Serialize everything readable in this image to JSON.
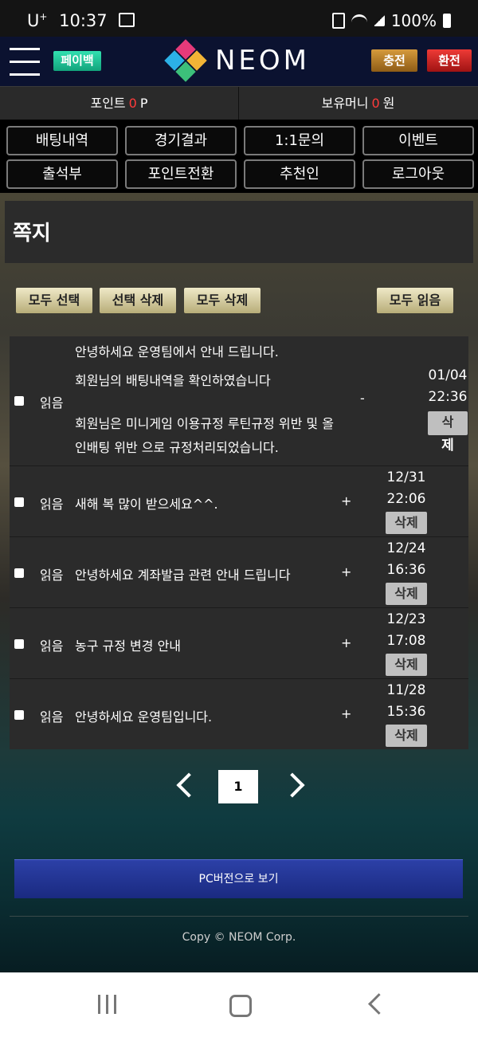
{
  "status_bar": {
    "carrier": "U",
    "carrier_sup": "+",
    "time": "10:37",
    "battery": "100%",
    "icons": [
      "gallery-icon",
      "nfc-icon",
      "wifi-icon",
      "signal-icon",
      "battery-icon"
    ]
  },
  "header": {
    "payback_label": "페이백",
    "logo_text": "NEOM",
    "charge_label": "충전",
    "exchange_label": "환전"
  },
  "balance": {
    "points_label": "포인트",
    "points_value": "0",
    "points_unit": "P",
    "money_label": "보유머니",
    "money_value": "0",
    "money_unit": "원"
  },
  "menu": [
    "배팅내역",
    "경기결과",
    "1:1문의",
    "이벤트",
    "출석부",
    "포인트전환",
    "추천인",
    "로그아웃"
  ],
  "page_title": "쪽지",
  "actions": {
    "select_all": "모두 선택",
    "delete_selected": "선택 삭제",
    "delete_all": "모두 삭제",
    "read_all": "모두 읽음"
  },
  "messages": [
    {
      "read_label": "읽음",
      "subject": "안녕하세요 운영팀에서 안내 드립니다.",
      "body_lines": [
        "회원님의 배팅내역을 확인하였습니다",
        "회원님은 미니게임 이용규정 루틴규정 위반 및 올",
        "인배팅 위반 으로 규정처리되었습니다."
      ],
      "toggle": "-",
      "date": "01/04",
      "time": "22:36",
      "delete_label_1": "삭",
      "delete_label_2": "제"
    },
    {
      "read_label": "읽음",
      "subject": "새해 복 많이 받으세요^^.",
      "toggle": "+",
      "date": "12/31",
      "time": "22:06",
      "delete_label": "삭제"
    },
    {
      "read_label": "읽음",
      "subject": "안녕하세요 계좌발급 관련 안내 드립니다",
      "toggle": "+",
      "date": "12/24",
      "time": "16:36",
      "delete_label": "삭제"
    },
    {
      "read_label": "읽음",
      "subject": "농구 규정 변경 안내",
      "toggle": "+",
      "date": "12/23",
      "time": "17:08",
      "delete_label": "삭제"
    },
    {
      "read_label": "읽음",
      "subject": "안녕하세요 운영팀입니다.",
      "toggle": "+",
      "date": "11/28",
      "time": "15:36",
      "delete_label": "삭제"
    }
  ],
  "pagination": {
    "current": "1"
  },
  "pc_version_label": "PC버전으로 보기",
  "footer": "Copy © NEOM Corp.",
  "colors": {
    "accent_red": "#ff3b3b",
    "payback_green": "#1fc893",
    "charge_gold": "#c08a30",
    "exchange_red": "#d42424",
    "pc_blue": "#24379a"
  }
}
